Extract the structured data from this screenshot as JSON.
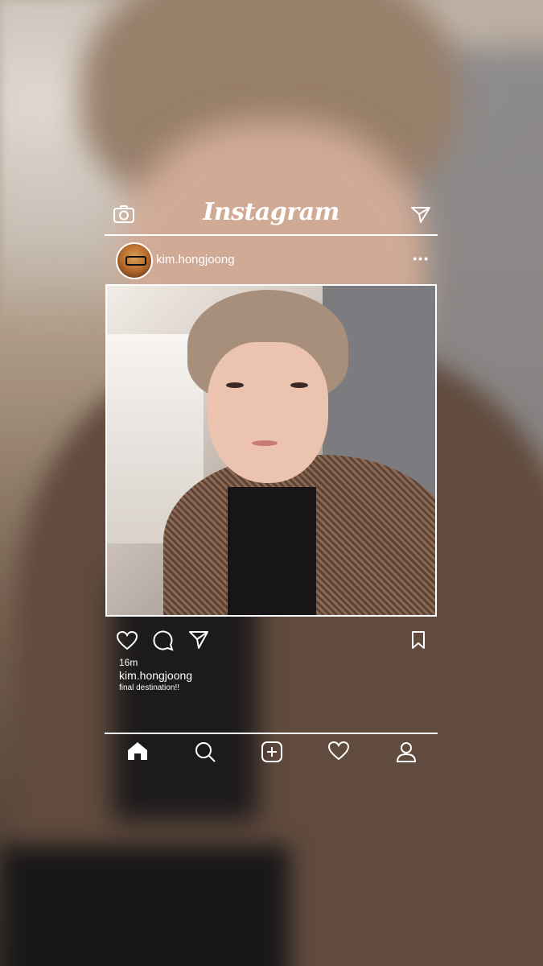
{
  "header": {
    "logo_text": "Instagram",
    "camera_icon": "camera-icon",
    "direct_icon": "paper-plane-icon"
  },
  "post": {
    "username": "kim.hongjoong",
    "more_label": "•••",
    "time_ago": "16m",
    "caption_user": "kim.hongjoong",
    "caption": "final destination!!"
  },
  "actions": {
    "icons": [
      "heart-icon",
      "comment-icon",
      "share-icon",
      "bookmark-icon"
    ]
  },
  "nav": {
    "icons": [
      "home-icon",
      "search-icon",
      "add-post-icon",
      "activity-heart-icon",
      "profile-icon"
    ]
  },
  "colors": {
    "foreground": "#ffffff",
    "coat_brown": "#6a5244",
    "skin": "#e3b9a3"
  }
}
